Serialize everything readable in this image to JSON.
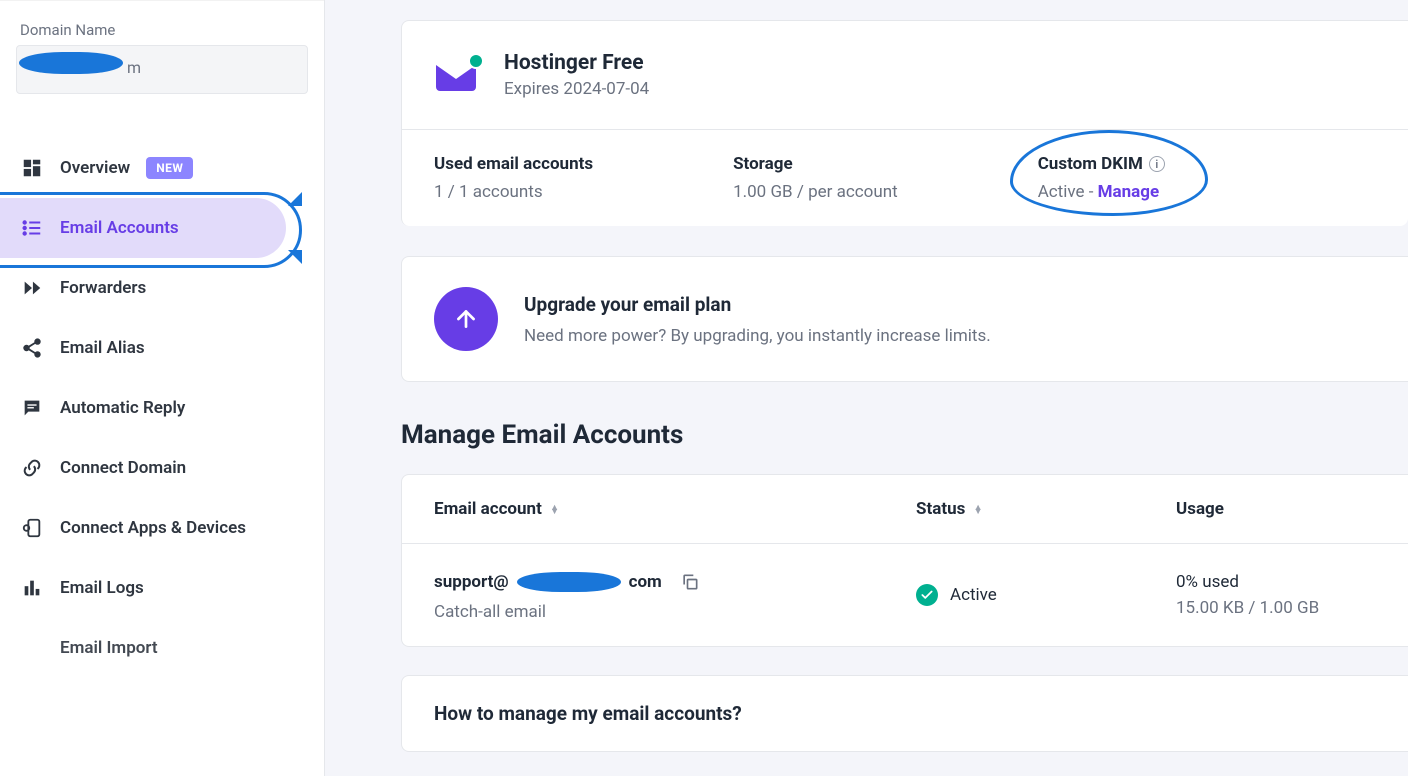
{
  "sidebar": {
    "domain_label": "Domain Name",
    "domain_value": "m",
    "items": [
      {
        "label": "Overview",
        "badge": "NEW"
      },
      {
        "label": "Email Accounts"
      },
      {
        "label": "Forwarders"
      },
      {
        "label": "Email Alias"
      },
      {
        "label": "Automatic Reply"
      },
      {
        "label": "Connect Domain"
      },
      {
        "label": "Connect Apps & Devices"
      },
      {
        "label": "Email Logs"
      },
      {
        "label": "Email Import"
      }
    ]
  },
  "plan": {
    "name": "Hostinger Free",
    "expires": "Expires 2024-07-04",
    "used_label": "Used email accounts",
    "used_value": "1 / 1 accounts",
    "storage_label": "Storage",
    "storage_value": "1.00 GB / per account",
    "dkim_label": "Custom DKIM",
    "dkim_status": "Active -",
    "dkim_manage": "Manage"
  },
  "upgrade": {
    "title": "Upgrade your email plan",
    "subtitle": "Need more power? By upgrading, you instantly increase limits."
  },
  "manage": {
    "title": "Manage Email Accounts",
    "columns": {
      "email": "Email account",
      "status": "Status",
      "usage": "Usage"
    },
    "rows": [
      {
        "email_prefix": "support@",
        "email_suffix": "com",
        "catchall": "Catch-all email",
        "status": "Active",
        "usage_pct": "0% used",
        "usage_detail": "15.00 KB / 1.00 GB"
      }
    ]
  },
  "faq": {
    "title": "How to manage my email accounts?"
  }
}
